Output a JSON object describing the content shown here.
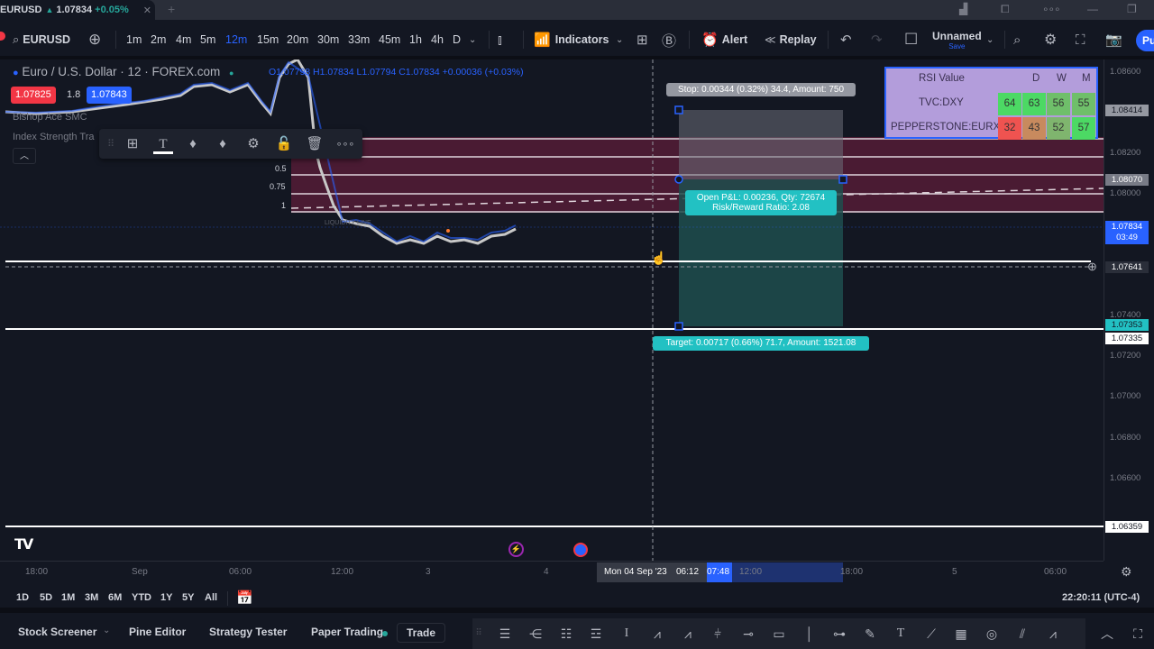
{
  "window": {
    "tab": {
      "symbol": "EURUSD",
      "price": "1.07834",
      "change": "+0.05%"
    },
    "controls": [
      "chart-layout-icon",
      "screen-share-icon",
      "more-icon",
      "minimize-icon",
      "restore-icon"
    ]
  },
  "toolbar": {
    "symbol_search": "EURUSD",
    "timeframes": [
      "1m",
      "2m",
      "4m",
      "5m",
      "12m",
      "15m",
      "20m",
      "30m",
      "33m",
      "45m",
      "1h",
      "4h",
      "D"
    ],
    "active_timeframe": "12m",
    "indicators_label": "Indicators",
    "alert_label": "Alert",
    "replay_label": "Replay",
    "layout_name": "Unnamed",
    "layout_save": "Save",
    "publish_label": "Pu"
  },
  "legend": {
    "title": "Euro / U.S. Dollar · 12 · FOREX.com",
    "ohlc": "O1.07798 H1.07834 L1.07794 C1.07834 +0.00036 (+0.03%)",
    "bid": "1.07825",
    "spread": "1.8",
    "ask": "1.07843",
    "indicators": [
      "Bishop Ace SMC",
      "Index Strength Tra"
    ],
    "liquidity_label": "LIQUIDITY LINE"
  },
  "fib": {
    "levels": [
      "0.5",
      "0.75",
      "1"
    ]
  },
  "rsi_table": {
    "title": "RSI Value",
    "columns": [
      "D",
      "W",
      "M"
    ],
    "rows": [
      {
        "symbol": "TVC:DXY",
        "values": [
          "64",
          "63",
          "56",
          "55"
        ],
        "colors": [
          "#4cd964",
          "#4cd964",
          "#6fbf6a",
          "#6fbf6a"
        ]
      },
      {
        "symbol": "PEPPERSTONE:EURX",
        "values": [
          "32",
          "43",
          "52",
          "57"
        ],
        "colors": [
          "#ef5350",
          "#c88a5e",
          "#7fb56e",
          "#4cd964"
        ]
      }
    ]
  },
  "position_tool": {
    "stop_label": "Stop: 0.00344 (0.32%) 34.4, Amount: 750",
    "pnl_line1": "Open P&L: 0.00236, Qty: 72674",
    "pnl_line2": "Risk/Reward Ratio: 2.08",
    "target_label": "Target: 0.00717 (0.66%) 71.7, Amount: 1521.08"
  },
  "price_axis": {
    "labels": [
      "1.08600",
      "1.08200",
      "1.08000",
      "1.07400",
      "1.07200",
      "1.07000",
      "1.06800",
      "1.06600"
    ],
    "tags": {
      "stop": "1.08414",
      "entry": "1.08070",
      "current": "1.07834",
      "countdown": "03:49",
      "crosshair": "1.07641",
      "target": "1.07353",
      "line1": "1.07335",
      "line2": "1.06359"
    },
    "colors": {
      "current": "#2962ff",
      "target": "#22c1c3",
      "stop": "#9598a1"
    }
  },
  "time_axis": {
    "labels": [
      "18:00",
      "Sep",
      "06:00",
      "12:00",
      "3",
      "4",
      "12:00",
      "18:00",
      "5",
      "06:00"
    ],
    "crosshair_date": "Mon 04 Sep '23",
    "range_start": "06:12",
    "range_end": "07:48"
  },
  "range_bar": {
    "ranges": [
      "1D",
      "5D",
      "1M",
      "3M",
      "6M",
      "YTD",
      "1Y",
      "5Y",
      "All"
    ],
    "clock": "22:20:11 (UTC-4)"
  },
  "bottom_panel": {
    "tabs": [
      "Stock Screener",
      "Pine Editor",
      "Strategy Tester",
      "Paper Trading",
      "Trade"
    ]
  },
  "drawing_tools": [
    "fib-retracement-icon",
    "trend-based-fib-icon",
    "fib-channel-icon",
    "fib-time-zone-icon",
    "fib-speed-icon",
    "pitchfork-icon",
    "abcd-pattern-icon",
    "xabcd-pattern-icon",
    "long-position-icon",
    "horizontal-ray-icon",
    "rectangle-icon",
    "vertical-line-icon",
    "cross-line-icon",
    "brush-icon",
    "text-icon",
    "trend-line-icon",
    "gann-box-icon",
    "circle-icon",
    "parallel-channel-icon",
    "path-icon"
  ]
}
